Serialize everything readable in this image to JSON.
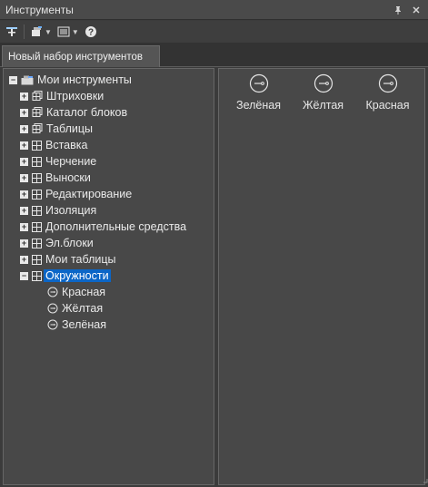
{
  "window": {
    "title": "Инструменты"
  },
  "titlebar": {
    "pin_icon": "pin-icon",
    "close_icon": "close-icon"
  },
  "toolbar": {
    "items": [
      "palette-tool-icon",
      "stack-tool-icon",
      "view-tool-icon",
      "help-icon"
    ]
  },
  "tabs": [
    {
      "label": "Новый набор инструментов"
    }
  ],
  "tree": {
    "root": {
      "label": "Мои инструменты"
    },
    "items": [
      {
        "label": "Штриховки",
        "icon": "stack"
      },
      {
        "label": "Каталог блоков",
        "icon": "stack"
      },
      {
        "label": "Таблицы",
        "icon": "stack"
      },
      {
        "label": "Вставка",
        "icon": "grid"
      },
      {
        "label": "Черчение",
        "icon": "grid"
      },
      {
        "label": "Выноски",
        "icon": "grid"
      },
      {
        "label": "Редактирование",
        "icon": "grid"
      },
      {
        "label": "Изоляция",
        "icon": "grid"
      },
      {
        "label": "Дополнительные средства",
        "icon": "grid"
      },
      {
        "label": "Эл.блоки",
        "icon": "grid"
      },
      {
        "label": "Мои таблицы",
        "icon": "grid"
      },
      {
        "label": "Окружности",
        "icon": "grid",
        "selected": true
      }
    ],
    "children": [
      {
        "label": "Красная"
      },
      {
        "label": "Жёлтая"
      },
      {
        "label": "Зелёная"
      }
    ]
  },
  "palette": [
    {
      "label": "Зелёная"
    },
    {
      "label": "Жёлтая"
    },
    {
      "label": "Красная"
    }
  ],
  "colors": {
    "selection": "#0b66c7",
    "panel": "#484848"
  }
}
